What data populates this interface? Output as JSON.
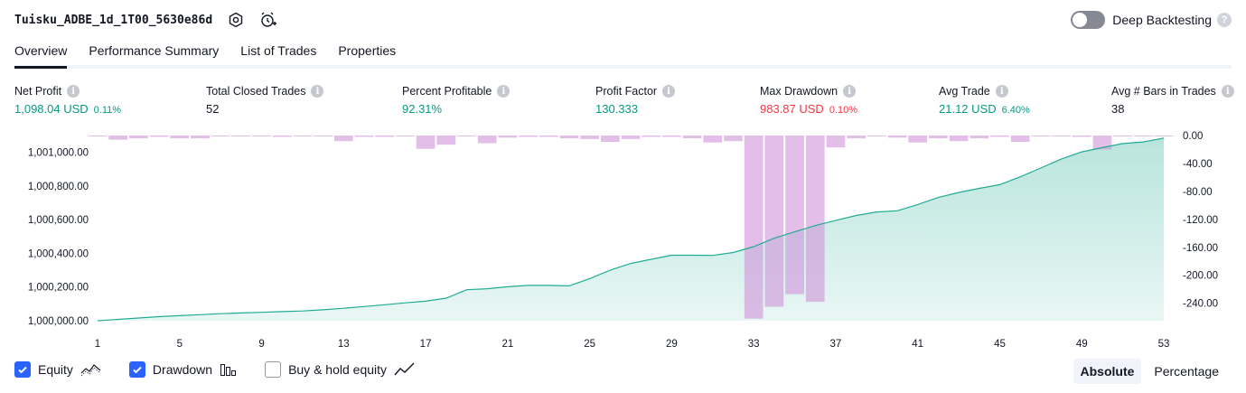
{
  "header": {
    "title": "Tuisku_ADBE_1d_1T00_5630e86d",
    "settings_icon": "gear-icon",
    "alert_icon": "alarm-clock-plus-icon"
  },
  "deep_backtesting": {
    "label": "Deep Backtesting",
    "enabled": false,
    "help": "?"
  },
  "tabs": [
    {
      "label": "Overview",
      "active": true
    },
    {
      "label": "Performance Summary",
      "active": false
    },
    {
      "label": "List of Trades",
      "active": false
    },
    {
      "label": "Properties",
      "active": false
    }
  ],
  "metrics": {
    "net_profit": {
      "label": "Net Profit",
      "value": "1,098.04 USD",
      "pct": "0.11%"
    },
    "closed_trades": {
      "label": "Total Closed Trades",
      "value": "52"
    },
    "percent_profitable": {
      "label": "Percent Profitable",
      "value": "92.31%"
    },
    "profit_factor": {
      "label": "Profit Factor",
      "value": "130.333"
    },
    "max_drawdown": {
      "label": "Max Drawdown",
      "value": "983.87 USD",
      "pct": "0.10%"
    },
    "avg_trade": {
      "label": "Avg Trade",
      "value": "21.12 USD",
      "pct": "6.40%"
    },
    "avg_bars": {
      "label": "Avg # Bars in Trades",
      "value": "38"
    },
    "info_glyph": "i"
  },
  "colors": {
    "positive": "#089981",
    "negative": "#f23645",
    "equity_line": "#22ab94",
    "equity_fill": "#22ab94",
    "drawdown_bar": "#ce93d8",
    "checkbox_on": "#2962ff"
  },
  "chart_data": {
    "type": "area",
    "x_ticks": [
      "1",
      "5",
      "9",
      "13",
      "17",
      "21",
      "25",
      "29",
      "33",
      "37",
      "41",
      "45",
      "49",
      "53"
    ],
    "x_range": [
      1,
      53
    ],
    "y_left": {
      "ticks": [
        "1,000,000.00",
        "1,000,200.00",
        "1,000,400.00",
        "1,000,600.00",
        "1,000,800.00",
        "1,001,000.00"
      ],
      "range": [
        1000000,
        1001100
      ]
    },
    "y_right": {
      "ticks": [
        "0.00",
        "-40.00",
        "-80.00",
        "-120.00",
        "-160.00",
        "-200.00",
        "-240.00"
      ],
      "range": [
        0,
        -265
      ]
    },
    "series": [
      {
        "name": "Equity",
        "x": [
          1,
          2,
          3,
          4,
          5,
          6,
          7,
          8,
          9,
          10,
          11,
          12,
          13,
          14,
          15,
          16,
          17,
          18,
          19,
          20,
          21,
          22,
          23,
          24,
          25,
          26,
          27,
          28,
          29,
          30,
          31,
          32,
          33,
          34,
          35,
          36,
          37,
          38,
          39,
          40,
          41,
          42,
          43,
          44,
          45,
          46,
          47,
          48,
          49,
          50,
          51,
          52,
          53
        ],
        "values": [
          1000000,
          1000008,
          1000016,
          1000024,
          1000030,
          1000036,
          1000042,
          1000046,
          1000050,
          1000054,
          1000058,
          1000065,
          1000074,
          1000084,
          1000095,
          1000106,
          1000116,
          1000134,
          1000184,
          1000190,
          1000202,
          1000210,
          1000210,
          1000207,
          1000250,
          1000300,
          1000340,
          1000365,
          1000389,
          1000389,
          1000388,
          1000405,
          1000440,
          1000490,
          1000528,
          1000565,
          1000596,
          1000625,
          1000646,
          1000653,
          1000690,
          1000732,
          1000762,
          1000786,
          1000808,
          1000855,
          1000907,
          1000960,
          1001003,
          1001028,
          1001052,
          1001062,
          1001085
        ]
      },
      {
        "name": "Drawdown",
        "type": "bar",
        "x": [
          1,
          2,
          3,
          4,
          5,
          6,
          7,
          8,
          9,
          10,
          11,
          12,
          13,
          14,
          15,
          16,
          17,
          18,
          19,
          20,
          21,
          22,
          23,
          24,
          25,
          26,
          27,
          28,
          29,
          30,
          31,
          32,
          33,
          34,
          35,
          36,
          37,
          38,
          39,
          40,
          41,
          42,
          43,
          44,
          45,
          46,
          47,
          48,
          49,
          50,
          51,
          52,
          53
        ],
        "values": [
          -1,
          -6,
          -4,
          -2,
          -4,
          -4,
          -1,
          -1,
          -1,
          -2,
          -1,
          -1,
          -8,
          -2,
          -2,
          -1,
          -19,
          -13,
          -1,
          -11,
          -3,
          -2,
          -2,
          -4,
          -5,
          -9,
          -5,
          -2,
          -2,
          -4,
          -10,
          -8,
          -262,
          -245,
          -227,
          -238,
          -17,
          -4,
          -1,
          -3,
          -10,
          -4,
          -8,
          -4,
          -2,
          -9,
          -1,
          -1,
          -2,
          -20,
          -1,
          -1,
          -1
        ]
      }
    ],
    "grid": false
  },
  "legend": {
    "items": [
      {
        "label": "Equity",
        "checked": true,
        "icon": "equity-area-icon"
      },
      {
        "label": "Drawdown",
        "checked": true,
        "icon": "drawdown-bars-icon"
      },
      {
        "label": "Buy & hold equity",
        "checked": false,
        "icon": "buy-hold-line-icon"
      }
    ]
  },
  "scale_toggle": {
    "absolute": "Absolute",
    "percentage": "Percentage",
    "selected": "Absolute"
  }
}
